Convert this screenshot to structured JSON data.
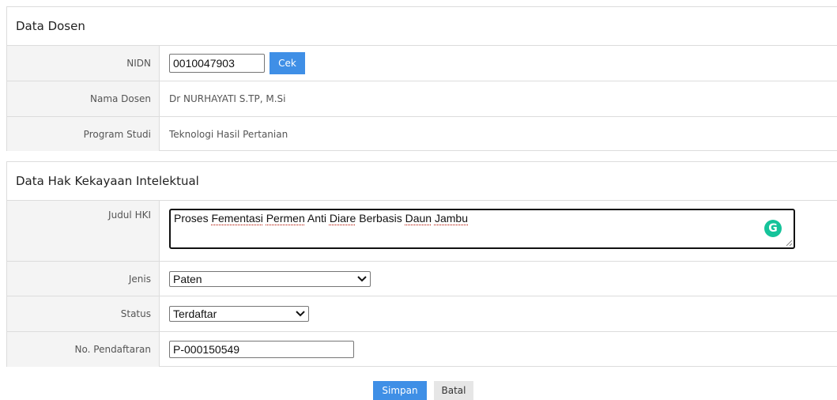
{
  "dosen": {
    "title": "Data Dosen",
    "nidn_label": "NIDN",
    "nidn_value": "0010047903",
    "cek_label": "Cek",
    "nama_label": "Nama Dosen",
    "nama_value": "Dr NURHAYATI S.TP, M.Si",
    "prodi_label": "Program Studi",
    "prodi_value": "Teknologi Hasil Pertanian"
  },
  "hki": {
    "title": "Data Hak Kekayaan Intelektual",
    "judul_label": "Judul HKI",
    "judul_words": [
      "Proses",
      "Fementasi",
      "Permen",
      "Anti",
      "Diare",
      "Berbasis",
      "Daun",
      "Jambu"
    ],
    "jenis_label": "Jenis",
    "jenis_value": "Paten",
    "status_label": "Status",
    "status_value": "Terdaftar",
    "nopendaftaran_label": "No. Pendaftaran",
    "nopendaftaran_value": "P-000150549"
  },
  "actions": {
    "simpan_label": "Simpan",
    "batal_label": "Batal"
  },
  "icons": {
    "grammar": "grammarly-icon",
    "dropdown": "chevron-down-icon",
    "resize": "resize-handle-icon"
  },
  "colors": {
    "primary_button": "#3f8fe6",
    "label_bg": "#f4f4f4",
    "grammarly": "#15c39a"
  }
}
